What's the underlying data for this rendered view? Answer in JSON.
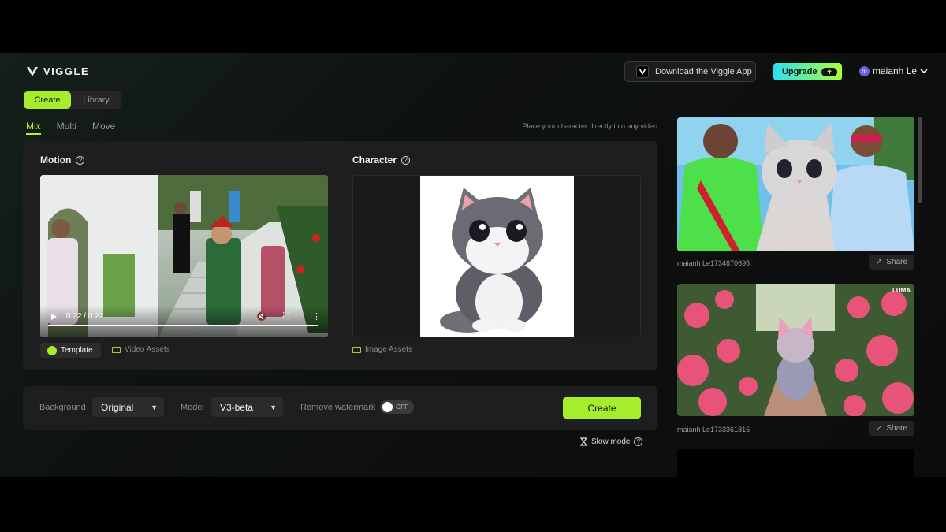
{
  "app": {
    "name": "VIGGLE"
  },
  "header": {
    "download_label": "Download the Viggle App",
    "upgrade_label": "Upgrade",
    "user_initial": "m",
    "user_name": "maianh Le"
  },
  "tabs": [
    {
      "label": "Create",
      "active": true
    },
    {
      "label": "Library",
      "active": false
    }
  ],
  "modes": [
    {
      "label": "Mix",
      "active": true
    },
    {
      "label": "Multi",
      "active": false
    },
    {
      "label": "Move",
      "active": false
    }
  ],
  "hint": "Place your character directly into any video",
  "motion": {
    "title": "Motion",
    "video_time": "0:22 / 0:22",
    "progress": 1.0,
    "template_label": "Template",
    "assets_label": "Video Assets"
  },
  "character": {
    "title": "Character",
    "assets_label": "Image Assets"
  },
  "settings": {
    "background_label": "Background",
    "background_value": "Original",
    "model_label": "Model",
    "model_value": "V3-beta",
    "watermark_label": "Remove watermark",
    "watermark_toggle": "OFF",
    "create_label": "Create",
    "slow_mode": "Slow mode"
  },
  "feed": [
    {
      "name": "maianh Le1734870695",
      "share": "Share"
    },
    {
      "name": "maianh Le1733361816",
      "share": "Share",
      "badge": "LUMA"
    }
  ],
  "colors": {
    "accent": "#a6ed2c",
    "panel": "#1e1e1e"
  }
}
